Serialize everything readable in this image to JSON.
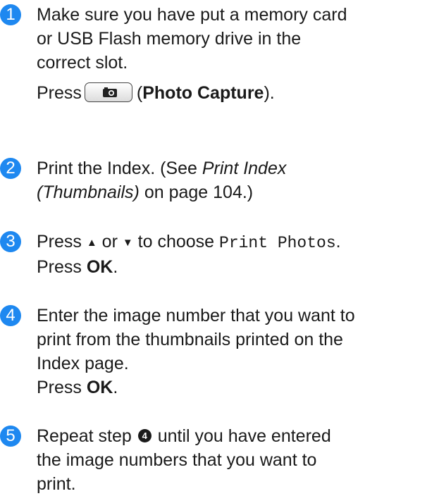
{
  "steps": [
    {
      "number": "1",
      "lines": [
        "Make sure you have put a memory card",
        "or USB Flash memory drive in the",
        "correct slot."
      ],
      "press_prefix": "Press",
      "button_icon": "camera-icon",
      "press_open": "(",
      "press_bold": "Photo Capture",
      "press_close": ")."
    },
    {
      "number": "2",
      "line1": "Print the Index. (See ",
      "line1_italic": "Print Index",
      "line2_italic": "(Thumbnails)",
      "line2_rest": " on page 104.)"
    },
    {
      "number": "3",
      "press": "Press ",
      "up_arrow": "▲",
      "or": " or ",
      "down_arrow": "▼",
      "to_choose": " to choose ",
      "menu_item": "Print Photos",
      "period": ".",
      "press2": "Press ",
      "ok": "OK",
      "period2": "."
    },
    {
      "number": "4",
      "lines": [
        "Enter the image number that you want to",
        "print from the thumbnails printed on the",
        "Index page."
      ],
      "press": "Press ",
      "ok": "OK",
      "period": "."
    },
    {
      "number": "5",
      "line1_a": "Repeat step ",
      "step_ref": "4",
      "line1_b": " until you have entered",
      "line2": "the image numbers that you want to",
      "line3": "print."
    }
  ]
}
